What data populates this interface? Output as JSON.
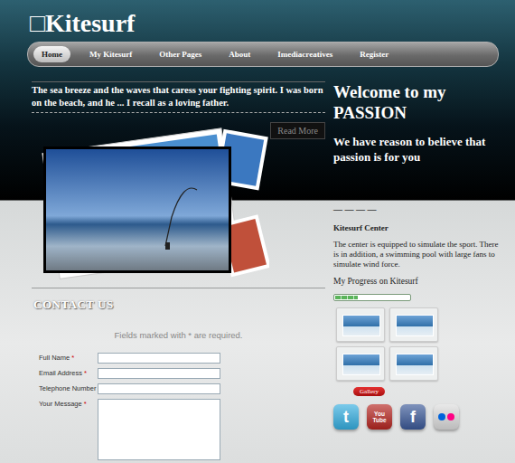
{
  "logo": "□Kitesurf",
  "nav": [
    {
      "label": "Home",
      "selected": true
    },
    {
      "label": "My Kitesurf",
      "selected": false
    },
    {
      "label": "Other Pages",
      "selected": false
    },
    {
      "label": "About",
      "selected": false
    },
    {
      "label": "Imediacreatives",
      "selected": false
    },
    {
      "label": "Register",
      "selected": false
    }
  ],
  "intro": {
    "text": "The sea breeze and the waves that caress your fighting spirit. I was born on the beach, and he ... I recall as a loving father.",
    "button": "Read More"
  },
  "welcome": {
    "title": "Welcome to my PASSION",
    "subtitle": "We have reason to believe that passion is for you"
  },
  "divider": "— — — —",
  "center": {
    "title": "Kitesurf Center",
    "text": "The center is equipped to simulate the sport. There is in addition, a swimming pool with large fans to simulate wind force."
  },
  "progress": {
    "label": "My Progress on Kitesurf",
    "level": 0.3
  },
  "gallery": {
    "button": "Gallery",
    "thumbnails": [
      {
        "kind": "photo"
      },
      {
        "kind": "photo"
      },
      {
        "kind": "photo"
      },
      {
        "kind": "photo"
      }
    ]
  },
  "social": [
    {
      "kind": "letter",
      "text": "t",
      "color": "#35aee0"
    },
    {
      "kind": "letter",
      "text": "You Tube",
      "color": "#b52520"
    },
    {
      "kind": "letter",
      "text": "f",
      "color": "#3b5998"
    },
    {
      "kind": "dots",
      "color": "#dcdcdc"
    }
  ],
  "contact": {
    "title": "CONTACT US",
    "note": "Fields marked with * are required.",
    "marker": "*",
    "fields": [
      {
        "label": "Full Name",
        "required": true,
        "kind": "input"
      },
      {
        "label": "Email Address",
        "required": true,
        "kind": "input"
      },
      {
        "label": "Telephone Number",
        "required": false,
        "kind": "input"
      },
      {
        "label": "Your Message",
        "required": true,
        "kind": "textarea"
      }
    ]
  }
}
